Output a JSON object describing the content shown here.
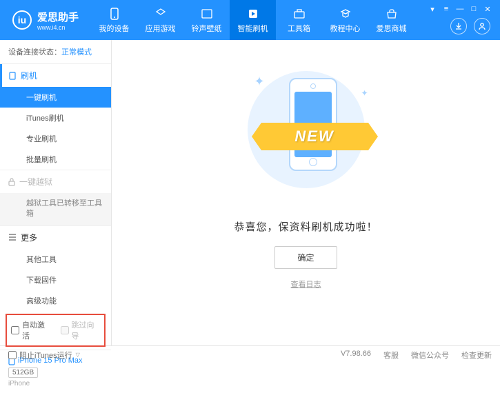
{
  "header": {
    "brand": "爱思助手",
    "url": "www.i4.cn",
    "nav": [
      {
        "label": "我的设备"
      },
      {
        "label": "应用游戏"
      },
      {
        "label": "铃声壁纸"
      },
      {
        "label": "智能刷机"
      },
      {
        "label": "工具箱"
      },
      {
        "label": "教程中心"
      },
      {
        "label": "爱思商城"
      }
    ]
  },
  "sidebar": {
    "status_label": "设备连接状态：",
    "status_mode": "正常模式",
    "flash_group": "刷机",
    "flash_items": [
      "一键刷机",
      "iTunes刷机",
      "专业刷机",
      "批量刷机"
    ],
    "jailbreak_group": "一键越狱",
    "jailbreak_note": "越狱工具已转移至工具箱",
    "more_group": "更多",
    "more_items": [
      "其他工具",
      "下载固件",
      "高级功能"
    ],
    "checkbox1": "自动激活",
    "checkbox2": "跳过向导",
    "device_name": "iPhone 15 Pro Max",
    "device_storage": "512GB",
    "device_type": "iPhone"
  },
  "main": {
    "new_badge": "NEW",
    "success": "恭喜您，保资料刷机成功啦！",
    "ok": "确定",
    "view_log": "查看日志"
  },
  "footer": {
    "block_itunes": "阻止iTunes运行",
    "version": "V7.98.66",
    "links": [
      "客服",
      "微信公众号",
      "检查更新"
    ]
  }
}
